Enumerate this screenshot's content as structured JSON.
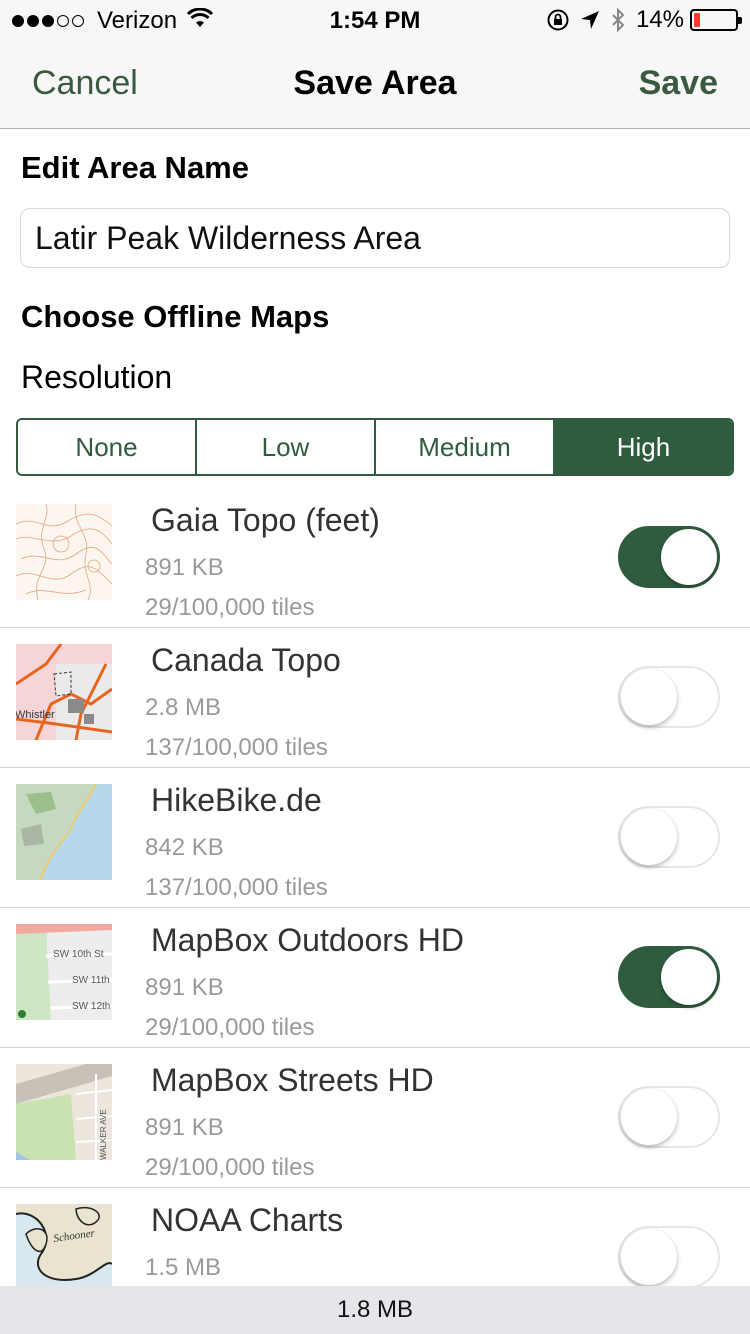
{
  "status_bar": {
    "carrier": "Verizon",
    "time": "1:54 PM",
    "battery_percent": "14%",
    "battery_level": 0.14,
    "signal_bars": 3,
    "signal_total": 5
  },
  "nav": {
    "cancel_label": "Cancel",
    "title": "Save Area",
    "save_label": "Save",
    "accent_color": "#3a5a40"
  },
  "form": {
    "edit_title": "Edit Area Name",
    "area_name": "Latir Peak Wilderness Area",
    "offline_title": "Choose Offline Maps",
    "resolution_label": "Resolution",
    "resolution_options": [
      "None",
      "Low",
      "Medium",
      "High"
    ],
    "resolution_selected": "High"
  },
  "maps": [
    {
      "name": "Gaia Topo (feet)",
      "size": "891 KB",
      "tiles": "29/100,000 tiles",
      "enabled": true,
      "icon": "topo-map-thumbnail"
    },
    {
      "name": "Canada Topo",
      "size": "2.8 MB",
      "tiles": "137/100,000 tiles",
      "enabled": false,
      "icon": "canada-topo-thumbnail",
      "thumb_label": "Whistler"
    },
    {
      "name": "HikeBike.de",
      "size": "842 KB",
      "tiles": "137/100,000 tiles",
      "enabled": false,
      "icon": "hikebike-thumbnail"
    },
    {
      "name": "MapBox Outdoors HD",
      "size": "891 KB",
      "tiles": "29/100,000 tiles",
      "enabled": true,
      "icon": "mapbox-outdoors-thumbnail",
      "thumb_streets": [
        "SW 10th St",
        "SW 11th",
        "SW 12th"
      ]
    },
    {
      "name": "MapBox Streets HD",
      "size": "891 KB",
      "tiles": "29/100,000 tiles",
      "enabled": false,
      "icon": "mapbox-streets-thumbnail",
      "thumb_label": "WALKER AVE"
    },
    {
      "name": "NOAA Charts",
      "size": "1.5 MB",
      "tiles": "",
      "enabled": false,
      "icon": "noaa-chart-thumbnail",
      "thumb_label": "Schooner"
    }
  ],
  "footer": {
    "total_size": "1.8 MB"
  }
}
